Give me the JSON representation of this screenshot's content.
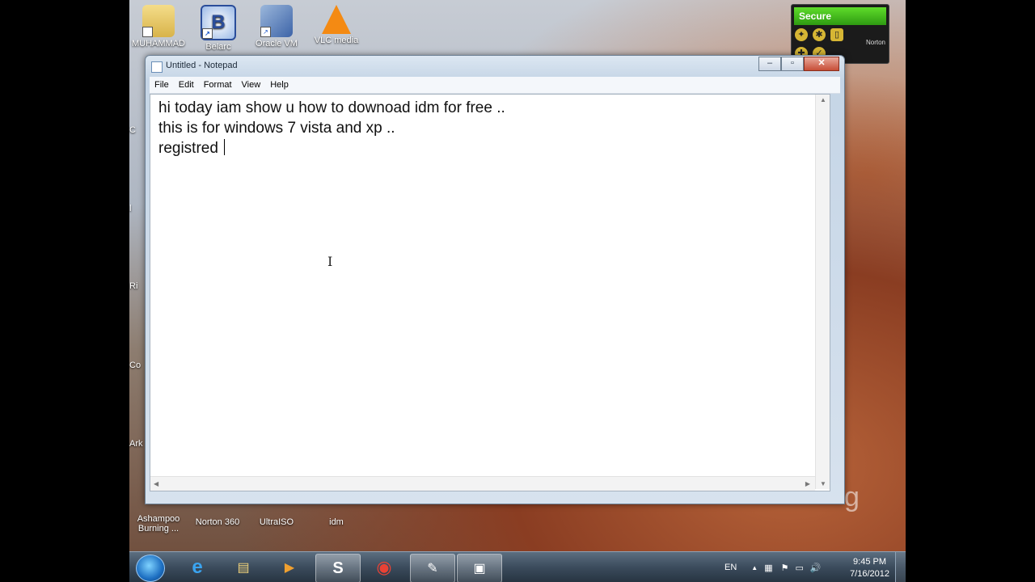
{
  "desktop": {
    "top_icons": [
      {
        "label": "MUHAMMAD",
        "icon": "user-folder-icon"
      },
      {
        "label": "Belarc",
        "icon": "belarc-icon"
      },
      {
        "label": "Oracle VM",
        "icon": "virtualbox-icon"
      },
      {
        "label": "VLC media",
        "icon": "vlc-icon"
      }
    ],
    "bottom_icons": [
      {
        "label": "Ashampoo Burning ...",
        "icon": "ashampoo-icon"
      },
      {
        "label": "Norton 360",
        "icon": "norton-icon"
      },
      {
        "label": "UltraISO",
        "icon": "ultraiso-icon"
      },
      {
        "label": "idm",
        "icon": "idm-icon"
      }
    ],
    "left_cut_labels": [
      "C",
      "l",
      "Ri",
      "Co",
      "Ark"
    ],
    "watermark": "g"
  },
  "norton_gadget": {
    "status": "Secure",
    "brand": "Norton"
  },
  "notepad": {
    "title": "Untitled - Notepad",
    "menu": [
      "File",
      "Edit",
      "Format",
      "View",
      "Help"
    ],
    "lines": [
      "hi today iam show u how to downoad idm for free ..",
      "this is for windows 7 vista and xp ..",
      "registred "
    ],
    "caption": {
      "minimize": "–",
      "maximize": "▫",
      "close": "✕"
    }
  },
  "taskbar": {
    "apps": [
      {
        "name": "internet-explorer",
        "glyph": "e",
        "active": false
      },
      {
        "name": "windows-explorer",
        "glyph": "▤",
        "active": false
      },
      {
        "name": "media-player",
        "glyph": "▶",
        "active": false
      },
      {
        "name": "skype",
        "glyph": "S",
        "active": true
      },
      {
        "name": "chrome",
        "glyph": "◉",
        "active": false
      },
      {
        "name": "notepad",
        "glyph": "✎",
        "active": true
      },
      {
        "name": "camtasia",
        "glyph": "▣",
        "active": true
      }
    ],
    "language": "EN",
    "time": "9:45 PM",
    "date": "7/16/2012"
  },
  "colors": {
    "accent_green": "#2e9a12",
    "skype_blue": "#00aff0"
  }
}
